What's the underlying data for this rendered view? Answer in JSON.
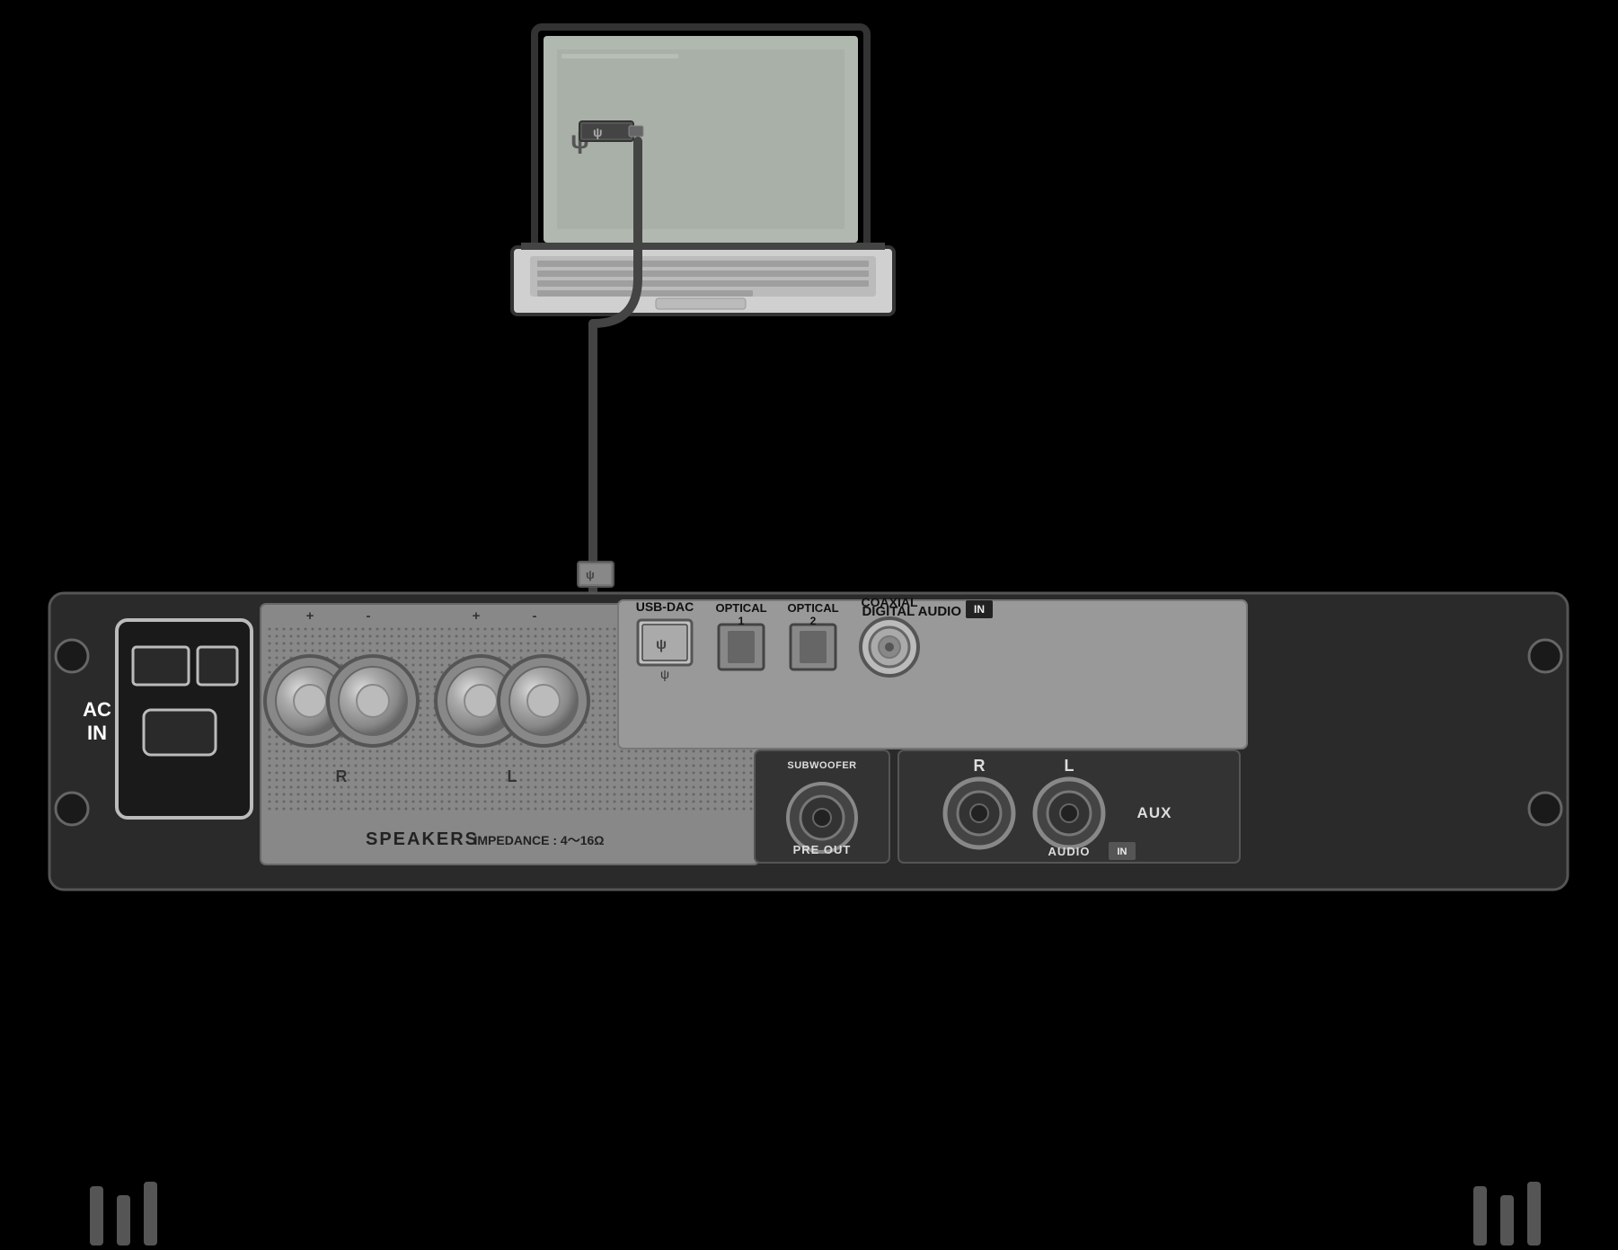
{
  "page": {
    "background_color": "#000000"
  },
  "labels": {
    "ac_in": "AC\nIN",
    "speakers": "SPEAKERS",
    "impedance": "IMPEDANCE : 4～16Ω",
    "speakers_r": "R",
    "speakers_l": "L",
    "speakers_plus_1": "+",
    "speakers_minus_1": "-",
    "speakers_plus_2": "+",
    "speakers_minus_2": "-",
    "pre_out": "PRE OUT",
    "subwoofer": "SUBWOOFER",
    "digital_audio_in": "DIGITAL AUDIO",
    "in_badge": "IN",
    "usb_dac": "USB-DAC",
    "optical_1": "OPTICAL\n1",
    "optical_2": "OPTICAL\n2",
    "coaxial": "COAXIAL",
    "audio_in": "AUDIO",
    "audio_in_badge": "IN",
    "audio_r": "R",
    "audio_l": "L",
    "aux": "AUX",
    "usb_symbol_top": "ψ",
    "usb_symbol_port": "ψ"
  }
}
